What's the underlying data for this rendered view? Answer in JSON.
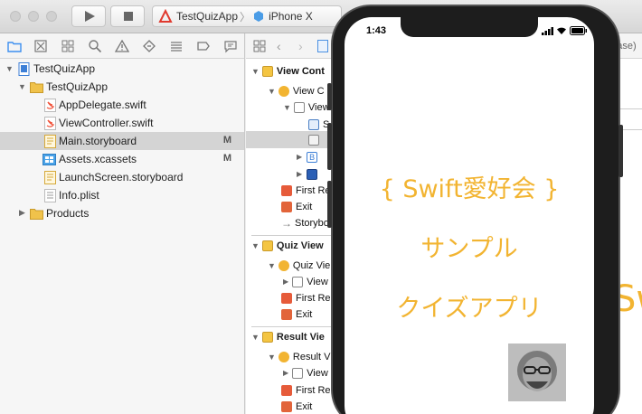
{
  "toolbar": {
    "project_name": "TestQuizApp",
    "device_name": "iPhone X",
    "separator": "〉"
  },
  "navigator": {
    "items": [
      {
        "label": "TestQuizApp",
        "badge": ""
      },
      {
        "label": "TestQuizApp",
        "badge": ""
      },
      {
        "label": "AppDelegate.swift",
        "badge": ""
      },
      {
        "label": "ViewController.swift",
        "badge": ""
      },
      {
        "label": "Main.storyboard",
        "badge": "M"
      },
      {
        "label": "Assets.xcassets",
        "badge": "M"
      },
      {
        "label": "LaunchScreen.storyboard",
        "badge": ""
      },
      {
        "label": "Info.plist",
        "badge": ""
      },
      {
        "label": "Products",
        "badge": ""
      }
    ]
  },
  "outline": {
    "jumpbar_tail": "n...ase)",
    "sections": [
      {
        "title": "View Cont"
      },
      {
        "title": "Quiz View"
      },
      {
        "title": "Result Vie"
      }
    ],
    "rows": [
      "View C",
      "View",
      "S",
      "",
      "B",
      "",
      "First Re",
      "Exit",
      "Storybo",
      "Quiz Vie",
      "View",
      "First Re",
      "Exit",
      "Result V",
      "View",
      "First Re",
      "Exit"
    ]
  },
  "simulator": {
    "time": "1:43",
    "line1": "{ Swift愛好会 }",
    "line2": "サンプル",
    "line3": "クイズアプリ",
    "background_text": "Sw"
  },
  "colors": {
    "accent": "#f2b431",
    "selection": "#d4d4d4",
    "swift_orange": "#f05138",
    "folder_yellow": "#f0c24b"
  }
}
